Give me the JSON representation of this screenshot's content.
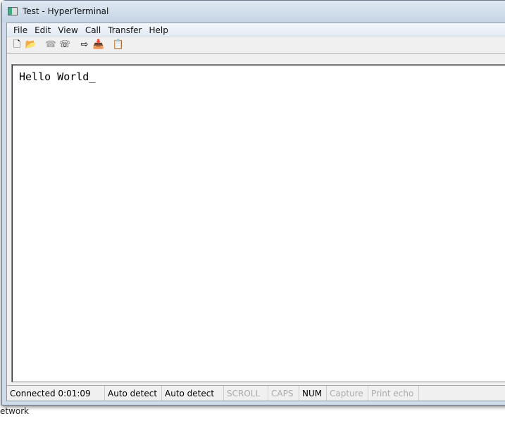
{
  "window": {
    "title": "Test - HyperTerminal"
  },
  "menu": [
    "File",
    "Edit",
    "View",
    "Call",
    "Transfer",
    "Help"
  ],
  "toolbar": [
    {
      "icon": "new-icon",
      "glyph": "🗋"
    },
    {
      "icon": "open-icon",
      "glyph": "📂"
    },
    {
      "icon": "disconnect-phone-icon",
      "glyph": "☎"
    },
    {
      "icon": "connect-phone-icon",
      "glyph": "☏"
    },
    {
      "icon": "send-icon",
      "glyph": "⇨"
    },
    {
      "icon": "receive-icon",
      "glyph": "📥"
    },
    {
      "icon": "properties-icon",
      "glyph": "📋"
    }
  ],
  "terminal": {
    "text": "Hello World_"
  },
  "status": [
    {
      "label": "Connected 0:01:09",
      "enabled": true
    },
    {
      "label": "Auto detect",
      "enabled": true
    },
    {
      "label": "Auto detect",
      "enabled": true
    },
    {
      "label": "SCROLL",
      "enabled": false
    },
    {
      "label": "CAPS",
      "enabled": false
    },
    {
      "label": "NUM",
      "enabled": true
    },
    {
      "label": "Capture",
      "enabled": false
    },
    {
      "label": "Print echo",
      "enabled": false
    }
  ],
  "desktop": {
    "label": "etwork"
  }
}
